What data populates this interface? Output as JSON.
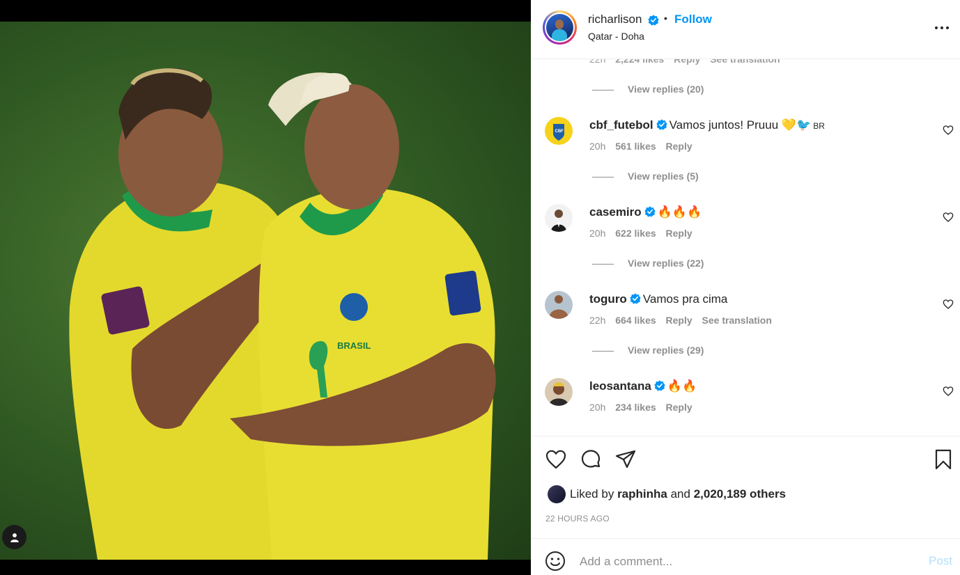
{
  "post": {
    "author": "richarlison",
    "separator": "•",
    "follow_label": "Follow",
    "location": "Qatar - Doha"
  },
  "comments": {
    "partial": {
      "time": "22h",
      "likes": "2,224 likes",
      "reply": "Reply",
      "translation": "See translation",
      "view_replies": "View replies (20)"
    },
    "items": [
      {
        "username": "cbf_futebol",
        "text": "Vamos juntos! Pruuu 💛🐦",
        "flag": "BR",
        "time": "20h",
        "likes": "561 likes",
        "reply": "Reply",
        "translation": "",
        "view_replies": "View replies (5)"
      },
      {
        "username": "casemiro",
        "text": "🔥🔥🔥",
        "flag": "",
        "time": "20h",
        "likes": "622 likes",
        "reply": "Reply",
        "translation": "",
        "view_replies": "View replies (22)"
      },
      {
        "username": "toguro",
        "text": "Vamos pra cima",
        "flag": "",
        "time": "22h",
        "likes": "664 likes",
        "reply": "Reply",
        "translation": "See translation",
        "view_replies": "View replies (29)"
      },
      {
        "username": "leosantana",
        "text": "🔥🔥",
        "flag": "",
        "time": "20h",
        "likes": "234 likes",
        "reply": "Reply",
        "translation": "",
        "view_replies": ""
      }
    ]
  },
  "likes": {
    "prefix": "Liked by",
    "user": "raphinha",
    "middle": "and",
    "others": "2,020,189 others"
  },
  "timestamp": "22 HOURS AGO",
  "composer": {
    "placeholder": "Add a comment...",
    "post_label": "Post"
  },
  "colors": {
    "link_blue": "#0095f6",
    "post_disabled": "#b2dffc",
    "verified": "#0095f6",
    "muted": "#8e8e8e"
  },
  "icons": [
    "user-tag-icon",
    "verified-icon",
    "more-icon",
    "heart-icon",
    "comment-icon",
    "share-icon",
    "bookmark-icon",
    "emoji-icon"
  ]
}
